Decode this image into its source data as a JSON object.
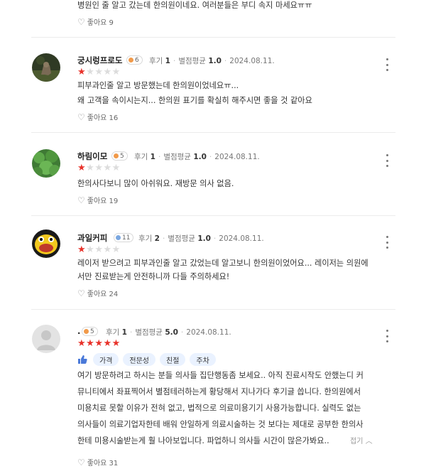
{
  "colors": {
    "star_on": "#e8322a",
    "star_off": "#dcdcdc",
    "tag_bg": "#eaf2ff"
  },
  "top_review": {
    "text": "병원인 줄 알고 갔는데 한의원이네요. 여러분들은 부디 속지 마세요ㅠㅠ",
    "likes": "좋아요 9"
  },
  "reviews": [
    {
      "nickname": "궁시렁프로도",
      "badge": "6",
      "review_count_label": "후기",
      "review_count": "1",
      "avg_label": "별점평균",
      "avg": "1.0",
      "date": "2024.08.11.",
      "rating": 1,
      "lines": [
        "피부과인줄 알고 방문했는데 한의원이었네요ㅠ...",
        "왜 고객을 속이시는지... 한의원 표기를 확실히 해주시면 좋을 것 같아요"
      ],
      "likes": "좋아요 16"
    },
    {
      "nickname": "하림이모",
      "badge": "5",
      "review_count_label": "후기",
      "review_count": "1",
      "avg_label": "별점평균",
      "avg": "1.0",
      "date": "2024.08.11.",
      "rating": 1,
      "lines": [
        "한의사다보니 많이 아쉬워요. 재방문 의사 없음."
      ],
      "likes": "좋아요 19"
    },
    {
      "nickname": "과일커피",
      "badge": "11",
      "review_count_label": "후기",
      "review_count": "2",
      "avg_label": "별점평균",
      "avg": "1.0",
      "date": "2024.08.11.",
      "rating": 1,
      "lines": [
        "레이저 받으려고 피부과인줄 알고 갔었는데 알고보니 한의원이었어요... 레이저는 의원에",
        "서만 진료받는게 안전하니까 다들 주의하세요!"
      ],
      "likes": "좋아요 24"
    },
    {
      "nickname": ".",
      "badge": "5",
      "review_count_label": "후기",
      "review_count": "1",
      "avg_label": "별점평균",
      "avg": "5.0",
      "date": "2024.08.11.",
      "rating": 5,
      "tags": [
        "가격",
        "전문성",
        "친절",
        "주차"
      ],
      "lines": [
        "여기 방문하려고 하시는 분들 의사들 집단행동좀 보세요.. 아직 진료시작도 안했는디 커",
        "뮤니티에서 좌표찍어서 별점테러하는게 황당해서 지나가다 후기글 씁니다. 한의원에서",
        "미용치료 못할 이유가 전혀 없고, 법적으로 의료미용기기 사용가능합니다. 실력도 없는",
        "의사들이 의료기업자한테 배워 안일하게 의료시술하는 것 보다는 제대로 공부한 한의사",
        "한테 미용시술받는게 훨 나아보입니다. 파업하니 의사들 시간이 많은가봐요.."
      ],
      "fold_label": "접기",
      "likes": "좋아요 31"
    }
  ]
}
